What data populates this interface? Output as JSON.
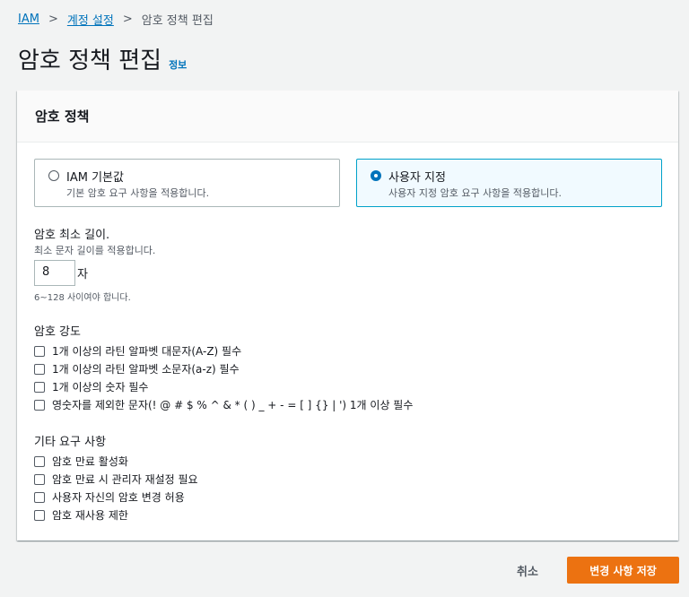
{
  "breadcrumb": {
    "root": "IAM",
    "parent": "계정 설정",
    "current": "암호 정책 편집"
  },
  "page": {
    "title": "암호 정책 편집",
    "info": "정보"
  },
  "panel": {
    "title": "암호 정책",
    "options": [
      {
        "label": "IAM 기본값",
        "description": "기본 암호 요구 사항을 적용합니다.",
        "selected": false
      },
      {
        "label": "사용자 지정",
        "description": "사용자 지정 암호 요구 사항을 적용합니다.",
        "selected": true
      }
    ],
    "min_length": {
      "label": "암호 최소 길이.",
      "description": "최소 문자 길이를 적용합니다.",
      "value": "8",
      "unit": "자",
      "constraint": "6~128 사이여야 합니다."
    },
    "strength": {
      "title": "암호 강도",
      "items": [
        "1개 이상의 라틴 알파벳 대문자(A-Z) 필수",
        "1개 이상의 라틴 알파벳 소문자(a-z) 필수",
        "1개 이상의 숫자 필수",
        "영숫자를 제외한 문자(! @ # $ % ^ & * ( ) _ + - = [ ] {} | ') 1개 이상 필수"
      ]
    },
    "other": {
      "title": "기타 요구 사항",
      "items": [
        "암호 만료 활성화",
        "암호 만료 시 관리자 재설정 필요",
        "사용자 자신의 암호 변경 허용",
        "암호 재사용 제한"
      ]
    }
  },
  "actions": {
    "cancel": "취소",
    "save": "변경 사항 저장"
  },
  "colors": {
    "link": "#0073bb",
    "primary": "#ec7211",
    "selected_border": "#00a1c9"
  }
}
